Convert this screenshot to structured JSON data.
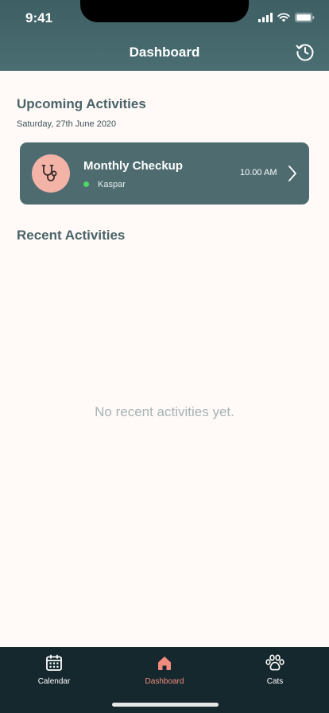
{
  "status_bar": {
    "time": "9:41"
  },
  "header": {
    "title": "Dashboard",
    "history_icon": "history-icon"
  },
  "upcoming": {
    "title": "Upcoming Activities",
    "date": "Saturday, 27th June 2020",
    "activities": [
      {
        "title": "Monthly Checkup",
        "cat": "Kaspar",
        "time": "10.00 AM",
        "icon": "stethoscope-icon",
        "status_color": "#4cd964"
      }
    ]
  },
  "recent": {
    "title": "Recent Activities",
    "empty_message": "No recent activities yet."
  },
  "tabbar": {
    "tabs": [
      {
        "label": "Calendar",
        "icon": "calendar-icon",
        "active": false
      },
      {
        "label": "Dashboard",
        "icon": "home-icon",
        "active": true
      },
      {
        "label": "Cats",
        "icon": "paw-icon",
        "active": false
      }
    ]
  },
  "colors": {
    "header": "#4a6e72",
    "card": "#4e6b6f",
    "accent": "#f28b7d",
    "tabbar": "#15282d",
    "background": "#fffaf8"
  }
}
